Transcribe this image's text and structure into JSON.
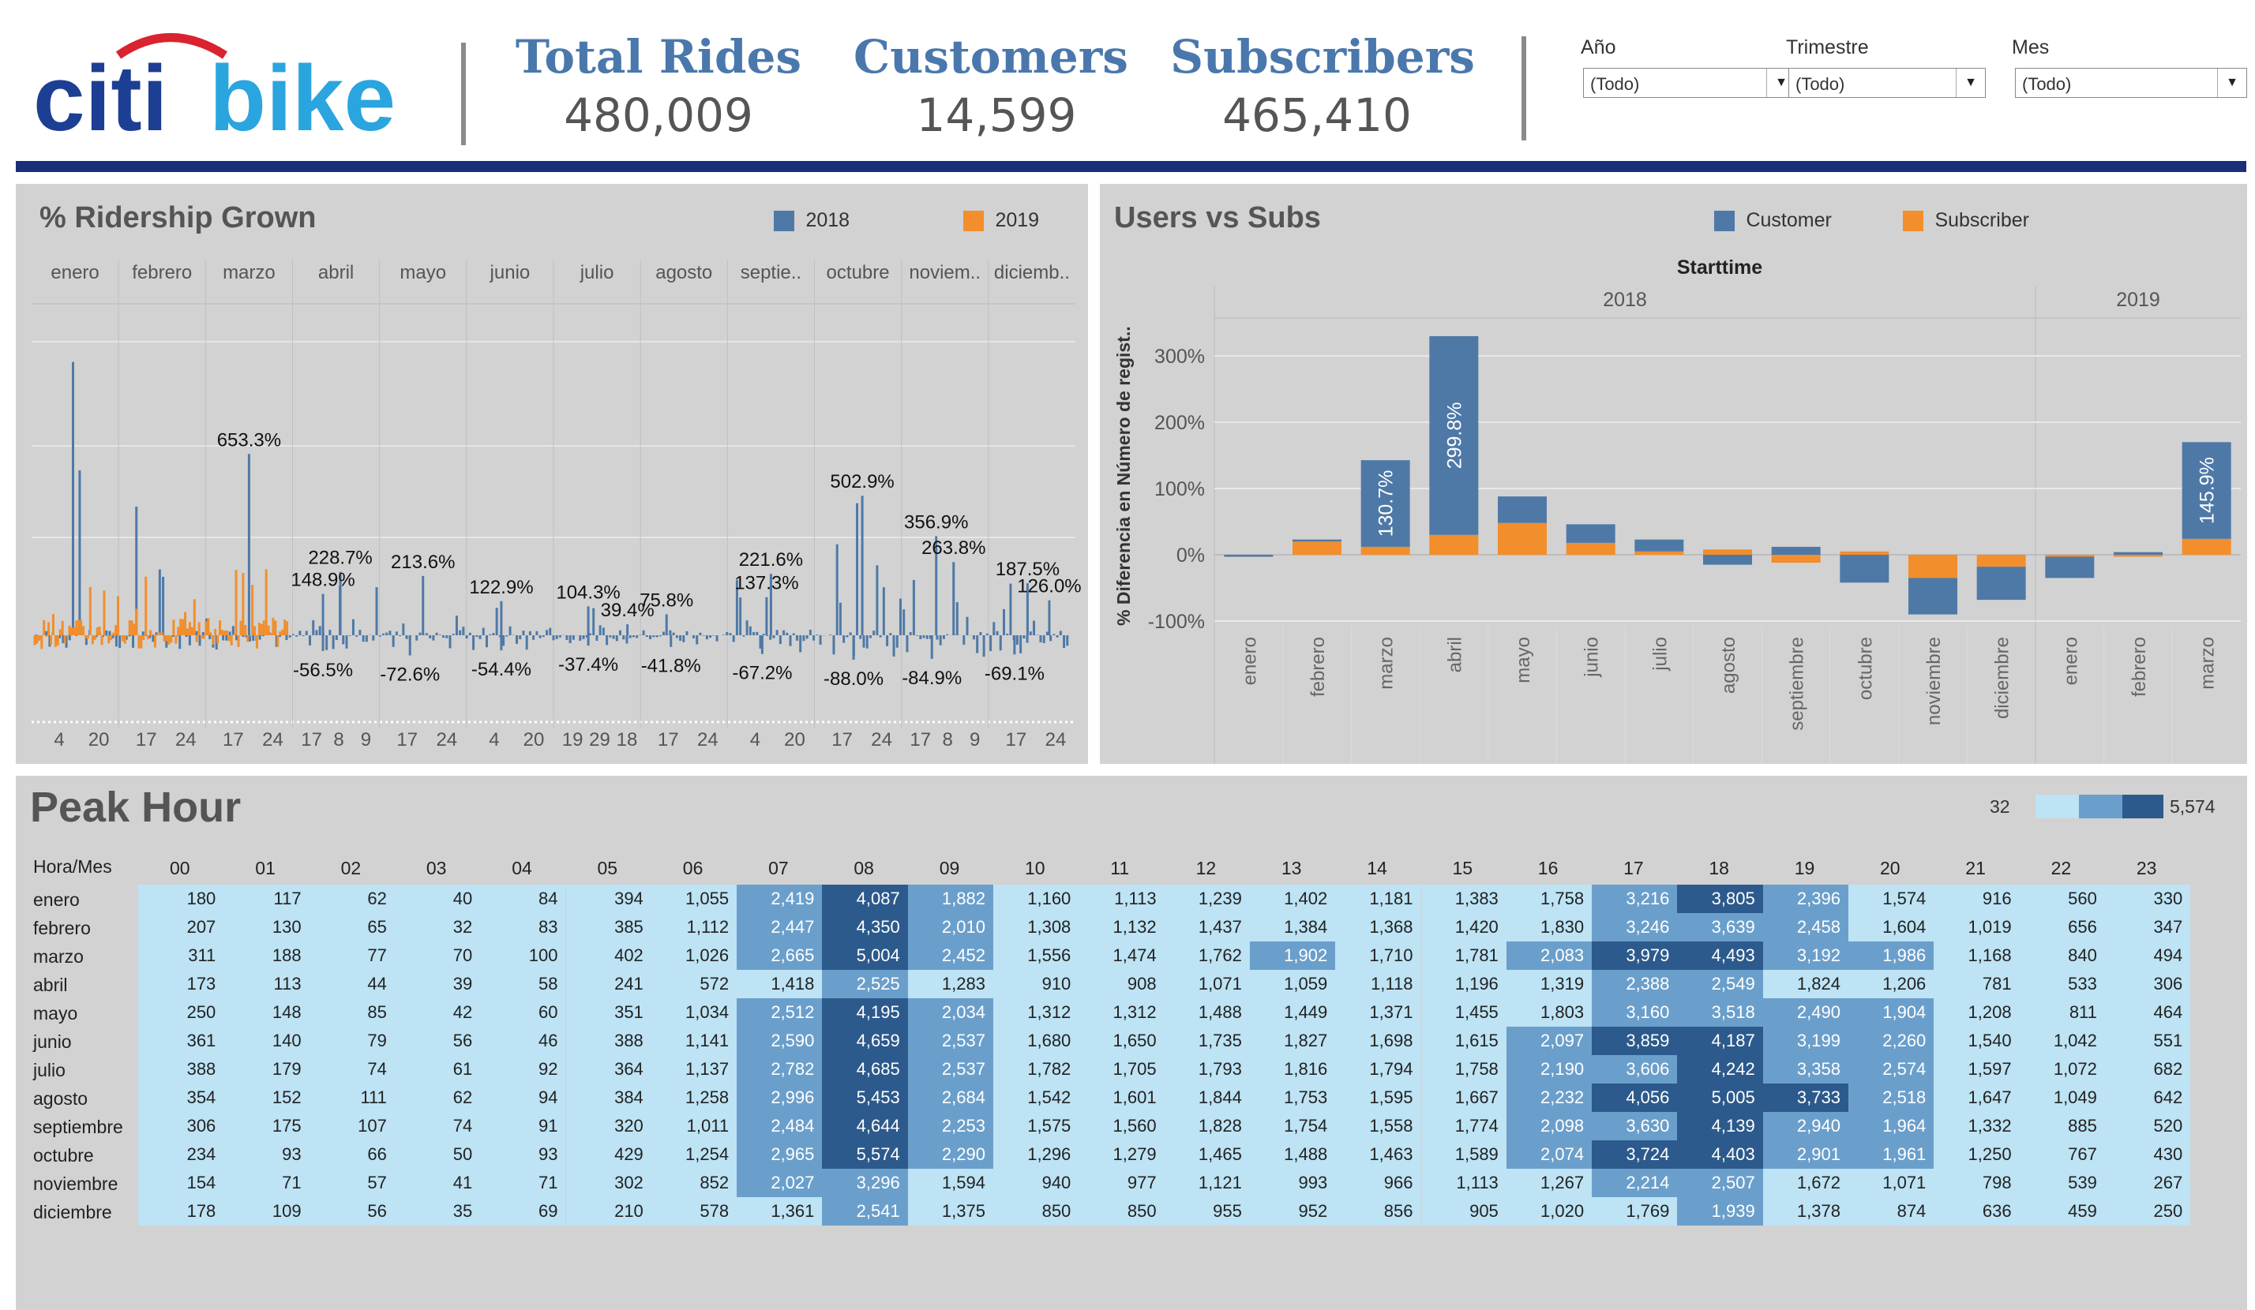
{
  "header": {
    "logo_text_left": "citi",
    "logo_text_right": "bike",
    "kpis": [
      {
        "label": "Total Rides",
        "value": "480,009"
      },
      {
        "label": "Customers",
        "value": "14,599"
      },
      {
        "label": "Subscribers",
        "value": "465,410"
      }
    ],
    "filters": [
      {
        "label": "Año",
        "value": "(Todo)"
      },
      {
        "label": "Trimestre",
        "value": "(Todo)"
      },
      {
        "label": "Mes",
        "value": "(Todo)"
      }
    ]
  },
  "colors": {
    "blue": "#4e79a7",
    "orange": "#f28e2b",
    "navy": "#1a2f7a",
    "brand_blue": "#4a78ac"
  },
  "ridership": {
    "title": "% Ridership Grown",
    "legend": [
      {
        "name": "2018",
        "color": "#4e79a7"
      },
      {
        "name": "2019",
        "color": "#f28e2b"
      }
    ],
    "months": [
      "enero",
      "febrero",
      "marzo",
      "abril",
      "mayo",
      "junio",
      "julio",
      "agosto",
      "septie..",
      "octubre",
      "noviem..",
      "diciemb.."
    ],
    "day_ticks": [
      [
        "4",
        "20"
      ],
      [
        "17",
        "24"
      ],
      [
        "17",
        "24"
      ],
      [
        "17",
        "8",
        "9"
      ],
      [
        "17",
        "24"
      ],
      [
        "4",
        "20"
      ],
      [
        "19",
        "29",
        "18"
      ],
      [
        "17",
        "24"
      ],
      [
        "4",
        "20"
      ],
      [
        "17",
        "24"
      ],
      [
        "17",
        "8",
        "9"
      ],
      [
        "17",
        "24"
      ]
    ],
    "annotations": [
      {
        "text": "653.3%",
        "month": 2,
        "pos": 0.5,
        "value": 653.3
      },
      {
        "text": "228.7%",
        "month": 3,
        "pos": 0.55,
        "value": 228.7
      },
      {
        "text": "148.9%",
        "month": 3,
        "pos": 0.35,
        "value": 148.9
      },
      {
        "text": "213.6%",
        "month": 4,
        "pos": 0.5,
        "value": 213.6
      },
      {
        "text": "122.9%",
        "month": 5,
        "pos": 0.4,
        "value": 122.9
      },
      {
        "text": "104.3%",
        "month": 6,
        "pos": 0.4,
        "value": 104.3
      },
      {
        "text": "39.4%",
        "month": 6,
        "pos": 0.85,
        "value": 39.4
      },
      {
        "text": "75.8%",
        "month": 7,
        "pos": 0.3,
        "value": 75.8
      },
      {
        "text": "221.6%",
        "month": 8,
        "pos": 0.5,
        "value": 221.6
      },
      {
        "text": "137.3%",
        "month": 8,
        "pos": 0.45,
        "value": 137.3
      },
      {
        "text": "502.9%",
        "month": 9,
        "pos": 0.55,
        "value": 502.9
      },
      {
        "text": "356.9%",
        "month": 10,
        "pos": 0.4,
        "value": 356.9
      },
      {
        "text": "263.8%",
        "month": 10,
        "pos": 0.6,
        "value": 263.8
      },
      {
        "text": "187.5%",
        "month": 11,
        "pos": 0.45,
        "value": 187.5
      },
      {
        "text": "126.0%",
        "month": 11,
        "pos": 0.7,
        "value": 126.0
      },
      {
        "text": "-56.5%",
        "month": 3,
        "pos": 0.35,
        "value": -56.5
      },
      {
        "text": "-72.6%",
        "month": 4,
        "pos": 0.35,
        "value": -72.6
      },
      {
        "text": "-54.4%",
        "month": 5,
        "pos": 0.4,
        "value": -54.4
      },
      {
        "text": "-37.4%",
        "month": 6,
        "pos": 0.4,
        "value": -37.4
      },
      {
        "text": "-41.8%",
        "month": 7,
        "pos": 0.35,
        "value": -41.8
      },
      {
        "text": "-67.2%",
        "month": 8,
        "pos": 0.4,
        "value": -67.2
      },
      {
        "text": "-88.0%",
        "month": 9,
        "pos": 0.45,
        "value": -88.0
      },
      {
        "text": "-84.9%",
        "month": 10,
        "pos": 0.35,
        "value": -84.9
      },
      {
        "text": "-69.1%",
        "month": 11,
        "pos": 0.3,
        "value": -69.1
      }
    ]
  },
  "users_subs": {
    "title": "Users vs Subs",
    "legend": [
      {
        "name": "Customer",
        "color": "#4e79a7"
      },
      {
        "name": "Subscriber",
        "color": "#f28e2b"
      }
    ],
    "column_header": "Starttime",
    "years": [
      {
        "label": "2018",
        "months": 12
      },
      {
        "label": "2019",
        "months": 3
      }
    ],
    "y_axis_label": "% Diferencia en Número de regist..",
    "y_ticks": [
      "300%",
      "200%",
      "100%",
      "0%",
      "-100%"
    ]
  },
  "chart_data": [
    {
      "type": "line",
      "title": "% Ridership Grown",
      "series": [
        {
          "name": "2018"
        },
        {
          "name": "2019"
        }
      ],
      "categories": [
        "enero",
        "febrero",
        "marzo",
        "abril",
        "mayo",
        "junio",
        "julio",
        "agosto",
        "septie..",
        "octubre",
        "noviem..",
        "diciemb.."
      ],
      "labeled_values": [
        653.3,
        228.7,
        148.9,
        213.6,
        122.9,
        104.3,
        39.4,
        75.8,
        221.6,
        137.3,
        502.9,
        356.9,
        263.8,
        187.5,
        126.0,
        -56.5,
        -72.6,
        -54.4,
        -37.4,
        -41.8,
        -67.2,
        -88.0,
        -84.9,
        -69.1
      ],
      "legend": "top-right"
    },
    {
      "type": "bar",
      "title": "Users vs Subs",
      "stacked": true,
      "categories": [
        "enero",
        "febrero",
        "marzo",
        "abril",
        "mayo",
        "junio",
        "julio",
        "agosto",
        "septiembre",
        "octubre",
        "noviembre",
        "diciembre",
        "enero",
        "febrero",
        "marzo"
      ],
      "groups": [
        "2018",
        "2018",
        "2018",
        "2018",
        "2018",
        "2018",
        "2018",
        "2018",
        "2018",
        "2018",
        "2018",
        "2018",
        "2019",
        "2019",
        "2019"
      ],
      "series": [
        {
          "name": "Customer",
          "values": [
            -3,
            3,
            130.7,
            299.8,
            40,
            28,
            18,
            -15,
            12,
            -42,
            -55,
            -50,
            -32,
            4,
            145.9
          ]
        },
        {
          "name": "Subscriber",
          "values": [
            0,
            20,
            12,
            30,
            48,
            18,
            5,
            8,
            -12,
            5,
            -35,
            -18,
            -3,
            -3,
            24
          ]
        }
      ],
      "data_labels": [
        "130.7%",
        "299.8%",
        "145.9%"
      ],
      "ylim": [
        -100,
        330
      ],
      "ylabel": "% Diferencia en Número de regist..",
      "legend": "top-right"
    },
    {
      "type": "heatmap",
      "title": "Peak Hour",
      "row_header": "Hora/Mes",
      "columns": [
        "00",
        "01",
        "02",
        "03",
        "04",
        "05",
        "06",
        "07",
        "08",
        "09",
        "10",
        "11",
        "12",
        "13",
        "14",
        "15",
        "16",
        "17",
        "18",
        "19",
        "20",
        "21",
        "22",
        "23"
      ],
      "rows": [
        "enero",
        "febrero",
        "marzo",
        "abril",
        "mayo",
        "junio",
        "julio",
        "agosto",
        "septiembre",
        "octubre",
        "noviembre",
        "diciembre"
      ],
      "values": [
        [
          180,
          117,
          62,
          40,
          84,
          394,
          1055,
          2419,
          4087,
          1882,
          1160,
          1113,
          1239,
          1402,
          1181,
          1383,
          1758,
          3216,
          3805,
          2396,
          1574,
          916,
          560,
          330
        ],
        [
          207,
          130,
          65,
          32,
          83,
          385,
          1112,
          2447,
          4350,
          2010,
          1308,
          1132,
          1437,
          1384,
          1368,
          1420,
          1830,
          3246,
          3639,
          2458,
          1604,
          1019,
          656,
          347
        ],
        [
          311,
          188,
          77,
          70,
          100,
          402,
          1026,
          2665,
          5004,
          2452,
          1556,
          1474,
          1762,
          1902,
          1710,
          1781,
          2083,
          3979,
          4493,
          3192,
          1986,
          1168,
          840,
          494
        ],
        [
          173,
          113,
          44,
          39,
          58,
          241,
          572,
          1418,
          2525,
          1283,
          910,
          908,
          1071,
          1059,
          1118,
          1196,
          1319,
          2388,
          2549,
          1824,
          1206,
          781,
          533,
          306
        ],
        [
          250,
          148,
          85,
          42,
          60,
          351,
          1034,
          2512,
          4195,
          2034,
          1312,
          1312,
          1488,
          1449,
          1371,
          1455,
          1803,
          3160,
          3518,
          2490,
          1904,
          1208,
          811,
          464
        ],
        [
          361,
          140,
          79,
          56,
          46,
          388,
          1141,
          2590,
          4659,
          2537,
          1680,
          1650,
          1735,
          1827,
          1698,
          1615,
          2097,
          3859,
          4187,
          3199,
          2260,
          1540,
          1042,
          551
        ],
        [
          388,
          179,
          74,
          61,
          92,
          364,
          1137,
          2782,
          4685,
          2537,
          1782,
          1705,
          1793,
          1816,
          1794,
          1758,
          2190,
          3606,
          4242,
          3358,
          2574,
          1597,
          1072,
          682
        ],
        [
          354,
          152,
          111,
          62,
          94,
          384,
          1258,
          2996,
          5453,
          2684,
          1542,
          1601,
          1844,
          1753,
          1595,
          1667,
          2232,
          4056,
          5005,
          3733,
          2518,
          1647,
          1049,
          642
        ],
        [
          306,
          175,
          107,
          74,
          91,
          320,
          1011,
          2484,
          4644,
          2253,
          1575,
          1560,
          1828,
          1754,
          1558,
          1774,
          2098,
          3630,
          4139,
          2940,
          1964,
          1332,
          885,
          520
        ],
        [
          234,
          93,
          66,
          50,
          93,
          429,
          1254,
          2965,
          5574,
          2290,
          1296,
          1279,
          1465,
          1488,
          1463,
          1589,
          2074,
          3724,
          4403,
          2901,
          1961,
          1250,
          767,
          430
        ],
        [
          154,
          71,
          57,
          41,
          71,
          302,
          852,
          2027,
          3296,
          1594,
          940,
          977,
          1121,
          993,
          966,
          1113,
          1267,
          2214,
          2507,
          1672,
          1071,
          798,
          539,
          267
        ],
        [
          178,
          109,
          56,
          35,
          69,
          210,
          578,
          1361,
          2541,
          1375,
          850,
          850,
          955,
          952,
          856,
          905,
          1020,
          1769,
          1939,
          1378,
          874,
          636,
          459,
          250
        ]
      ],
      "legend": {
        "min": "32",
        "max": "5,574"
      }
    }
  ]
}
